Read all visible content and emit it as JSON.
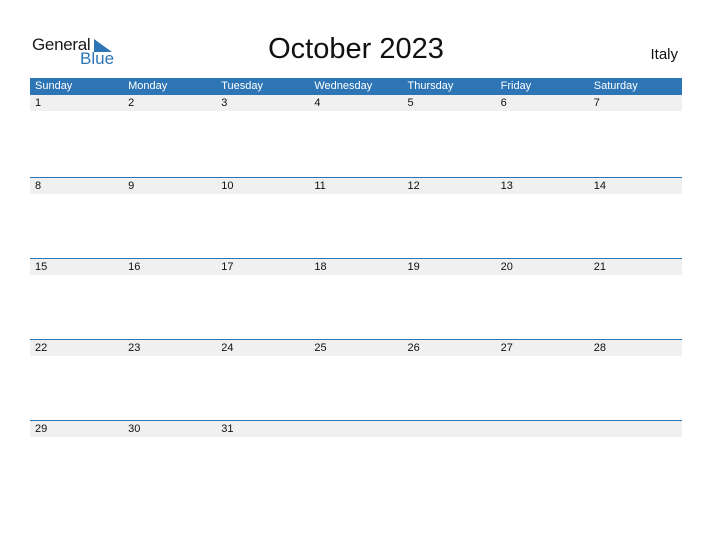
{
  "logo": {
    "line1": "General",
    "line2": "Blue"
  },
  "title": "October 2023",
  "country": "Italy",
  "colors": {
    "accent": "#2e75b6",
    "row_strip": "#f0f0f0"
  },
  "weekdays": [
    "Sunday",
    "Monday",
    "Tuesday",
    "Wednesday",
    "Thursday",
    "Friday",
    "Saturday"
  ],
  "weeks": [
    [
      "1",
      "2",
      "3",
      "4",
      "5",
      "6",
      "7"
    ],
    [
      "8",
      "9",
      "10",
      "11",
      "12",
      "13",
      "14"
    ],
    [
      "15",
      "16",
      "17",
      "18",
      "19",
      "20",
      "21"
    ],
    [
      "22",
      "23",
      "24",
      "25",
      "26",
      "27",
      "28"
    ],
    [
      "29",
      "30",
      "31",
      "",
      "",
      "",
      ""
    ]
  ]
}
